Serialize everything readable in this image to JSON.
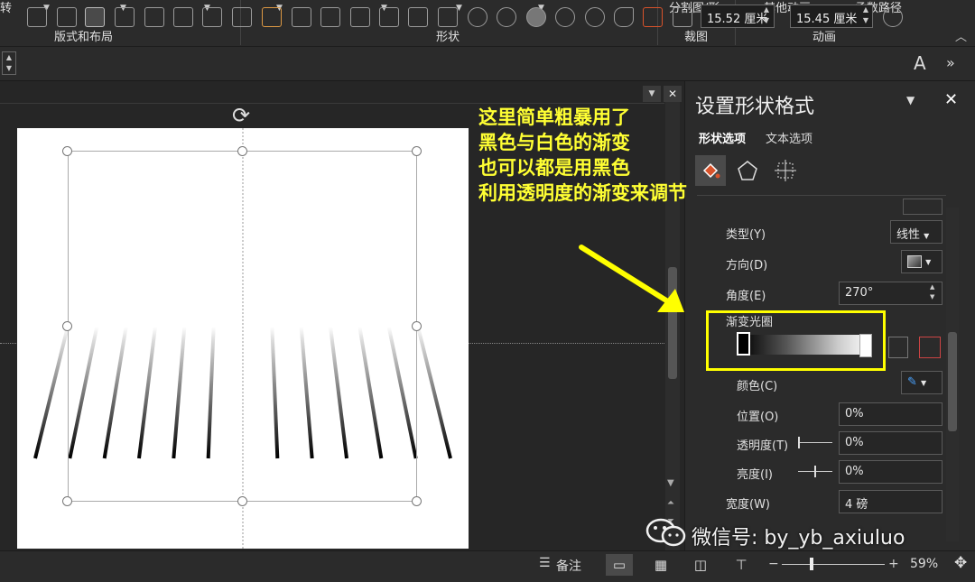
{
  "ribbon": {
    "top_left": "转",
    "groups": [
      "版式和布局",
      "形状",
      "裁图",
      "动画"
    ],
    "top_items": [
      "分割图/形",
      "其他动画",
      "函数路径"
    ],
    "collapse_glyph": "︿"
  },
  "toolbar": {
    "width_value": "15.52 厘米",
    "height_value": "15.45 厘米",
    "font_glyph": "A",
    "more_glyph": "»"
  },
  "annotation": {
    "lines": [
      "这里简单粗暴用了",
      "黑色与白色的渐变",
      "也可以都是用黑色",
      "利用透明度的渐变来调节"
    ]
  },
  "pane": {
    "title": "设置形状格式",
    "tab_shape": "形状选项",
    "tab_text": "文本选项",
    "type_label": "类型(Y)",
    "type_value": "线性",
    "direction_label": "方向(D)",
    "angle_label": "角度(E)",
    "angle_value": "270°",
    "stops_label": "渐变光圈",
    "color_label": "颜色(C)",
    "position_label": "位置(O)",
    "position_value": "0%",
    "transparency_label": "透明度(T)",
    "transparency_value": "0%",
    "brightness_label": "亮度(I)",
    "brightness_value": "0%",
    "width_label": "宽度(W)",
    "width_value": "4 磅"
  },
  "status": {
    "notes": "备注",
    "zoom": "59%",
    "zoom_level": 0.59
  },
  "watermark": {
    "text": "微信号: by_yb_axiuluo"
  },
  "colors": {
    "annotation": "#ffff33",
    "highlight_box": "#ffff00",
    "panel": "#2b2b2b",
    "accent_icon": "#d9532b"
  }
}
